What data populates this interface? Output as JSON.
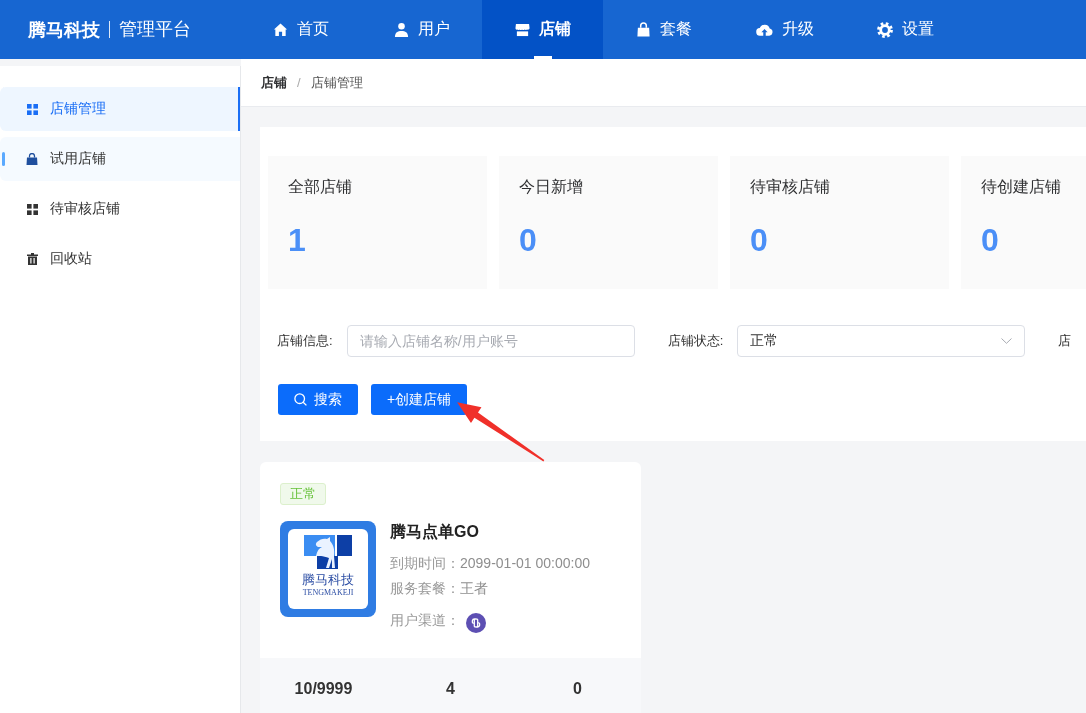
{
  "brand": {
    "name": "腾马科技",
    "subtitle": "管理平台"
  },
  "nav": {
    "items": [
      {
        "label": "首页",
        "selected": false
      },
      {
        "label": "用户",
        "selected": false
      },
      {
        "label": "店铺",
        "selected": true
      },
      {
        "label": "套餐",
        "selected": false
      },
      {
        "label": "升级",
        "selected": false
      },
      {
        "label": "设置",
        "selected": false
      }
    ]
  },
  "sidebar": {
    "items": [
      {
        "label": "店铺管理",
        "selected": true,
        "hovered": false
      },
      {
        "label": "试用店铺",
        "selected": false,
        "hovered": true
      },
      {
        "label": "待审核店铺",
        "selected": false,
        "hovered": false
      },
      {
        "label": "回收站",
        "selected": false,
        "hovered": false
      }
    ]
  },
  "breadcrumb": {
    "items": [
      {
        "label": "店铺",
        "link": true
      },
      {
        "label": "店铺管理",
        "link": false
      }
    ],
    "separator": "/"
  },
  "stats": [
    {
      "label": "全部店铺",
      "value": "1"
    },
    {
      "label": "今日新增",
      "value": "0"
    },
    {
      "label": "待审核店铺",
      "value": "0"
    },
    {
      "label": "待创建店铺",
      "value": "0"
    }
  ],
  "filters": [
    {
      "kind": "input",
      "label": "店铺信息:",
      "placeholder": "请输入店铺名称/用户账号"
    },
    {
      "kind": "select",
      "label": "店铺状态:",
      "value": "正常"
    },
    {
      "kind": "label",
      "label": "店"
    }
  ],
  "actions": [
    {
      "kind": "search",
      "label": "搜索"
    },
    {
      "kind": "create",
      "label": "+创建店铺"
    }
  ],
  "store_card": {
    "status": "正常",
    "logo": {
      "name": "腾马科技",
      "subtitle": "TENGMAKEJI"
    },
    "name": "腾马点单GO",
    "details": [
      {
        "kind": "text",
        "label": "到期时间：",
        "value": "2099-01-01 00:00:00"
      },
      {
        "kind": "text",
        "label": "服务套餐：",
        "value": "王者"
      },
      {
        "kind": "icon",
        "label": "用户渠道："
      }
    ],
    "metrics": [
      "10/9999",
      "4",
      "0"
    ]
  }
}
